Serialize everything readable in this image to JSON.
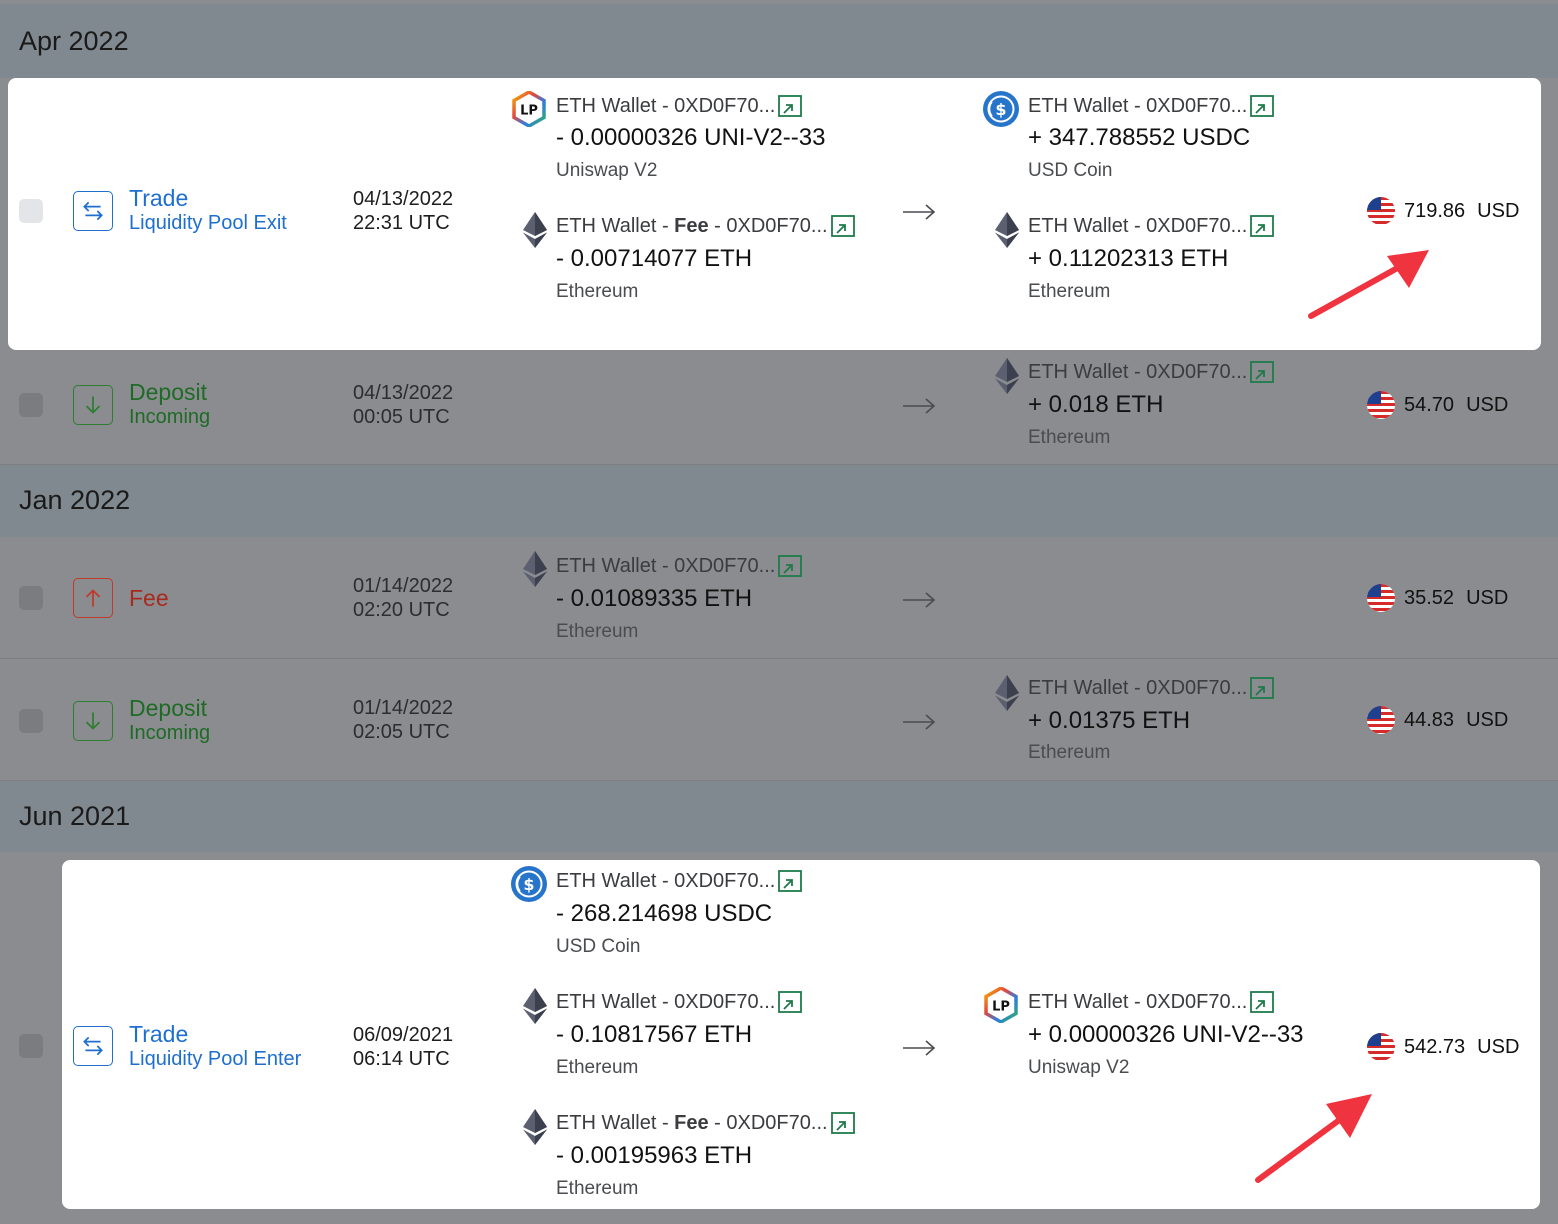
{
  "groups": [
    {
      "title": "Apr 2022"
    },
    {
      "title": "Jan 2022"
    },
    {
      "title": "Jun 2021"
    }
  ],
  "rows": [
    {
      "type": "Trade",
      "subtype": "Liquidity Pool Exit",
      "date": "04/13/2022",
      "time": "22:31 UTC",
      "out": [
        {
          "wallet": "ETH Wallet - 0XD0F70...",
          "amount": "- 0.00000326 UNI-V2--33",
          "asset": "Uniswap V2",
          "icon": "lp-icon"
        },
        {
          "wallet_pre": "ETH Wallet - ",
          "fee": "Fee",
          "wallet_post": " - 0XD0F70...",
          "amount": "- 0.00714077 ETH",
          "asset": "Ethereum",
          "icon": "eth-icon"
        }
      ],
      "in": [
        {
          "wallet": "ETH Wallet - 0XD0F70...",
          "amount": "+ 347.788552 USDC",
          "asset": "USD Coin",
          "icon": "usdc-icon"
        },
        {
          "wallet": "ETH Wallet - 0XD0F70...",
          "amount": "+ 0.11202313 ETH",
          "asset": "Ethereum",
          "icon": "eth-icon"
        }
      ],
      "value": "719.86",
      "currency": "USD"
    },
    {
      "type": "Deposit",
      "subtype": "Incoming",
      "date": "04/13/2022",
      "time": "00:05 UTC",
      "in": [
        {
          "wallet": "ETH Wallet - 0XD0F70...",
          "amount": "+ 0.018 ETH",
          "asset": "Ethereum",
          "icon": "eth-icon"
        }
      ],
      "value": "54.70",
      "currency": "USD"
    },
    {
      "type": "Fee",
      "date": "01/14/2022",
      "time": "02:20 UTC",
      "out": [
        {
          "wallet": "ETH Wallet - 0XD0F70...",
          "amount": "- 0.01089335 ETH",
          "asset": "Ethereum",
          "icon": "eth-icon"
        }
      ],
      "value": "35.52",
      "currency": "USD"
    },
    {
      "type": "Deposit",
      "subtype": "Incoming",
      "date": "01/14/2022",
      "time": "02:05 UTC",
      "in": [
        {
          "wallet": "ETH Wallet - 0XD0F70...",
          "amount": "+ 0.01375 ETH",
          "asset": "Ethereum",
          "icon": "eth-icon"
        }
      ],
      "value": "44.83",
      "currency": "USD"
    },
    {
      "type": "Trade",
      "subtype": "Liquidity Pool Enter",
      "date": "06/09/2021",
      "time": "06:14 UTC",
      "out": [
        {
          "wallet": "ETH Wallet - 0XD0F70...",
          "amount": "- 268.214698 USDC",
          "asset": "USD Coin",
          "icon": "usdc-icon"
        },
        {
          "wallet": "ETH Wallet - 0XD0F70...",
          "amount": "- 0.10817567 ETH",
          "asset": "Ethereum",
          "icon": "eth-icon"
        },
        {
          "wallet_pre": "ETH Wallet - ",
          "fee": "Fee",
          "wallet_post": " - 0XD0F70...",
          "amount": "- 0.00195963 ETH",
          "asset": "Ethereum",
          "icon": "eth-icon"
        }
      ],
      "in": [
        {
          "wallet": "ETH Wallet - 0XD0F70...",
          "amount": "+ 0.00000326 UNI-V2--33",
          "asset": "Uniswap V2",
          "icon": "lp-icon"
        }
      ],
      "value": "542.73",
      "currency": "USD"
    }
  ],
  "colors": {
    "trade": "#1e6fd0",
    "deposit": "#2e7d32",
    "fee": "#c0392b",
    "annotation_arrow": "#f0343f"
  }
}
